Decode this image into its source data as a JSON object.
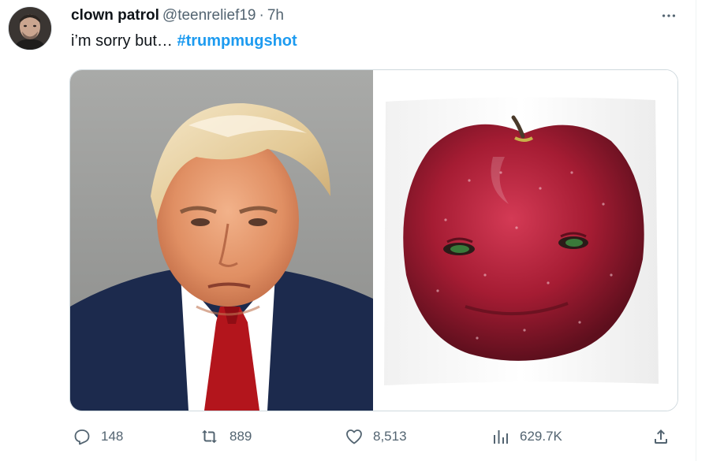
{
  "tweet": {
    "author": {
      "name": "clown patrol",
      "handle": "@teenrelief19",
      "separator": "·",
      "time": "7h",
      "avatar_icon": "profile-photo"
    },
    "text": {
      "prefix": "i’m sorry but… ",
      "hashtag": "#trumpmugshot"
    },
    "media": [
      {
        "name": "trump-mugshot-photo"
      },
      {
        "name": "apple-face-photo"
      }
    ],
    "actions": {
      "replies": "148",
      "reposts": "889",
      "likes": "8,513",
      "views": "629.7K"
    }
  },
  "icons": {
    "more": "more-horizontal-icon",
    "reply": "reply-icon",
    "repost": "repost-icon",
    "like": "heart-icon",
    "views": "views-icon",
    "share": "share-icon"
  },
  "colors": {
    "accent": "#1d9bf0",
    "secondary_text": "#536471",
    "border": "#cfd9de"
  }
}
